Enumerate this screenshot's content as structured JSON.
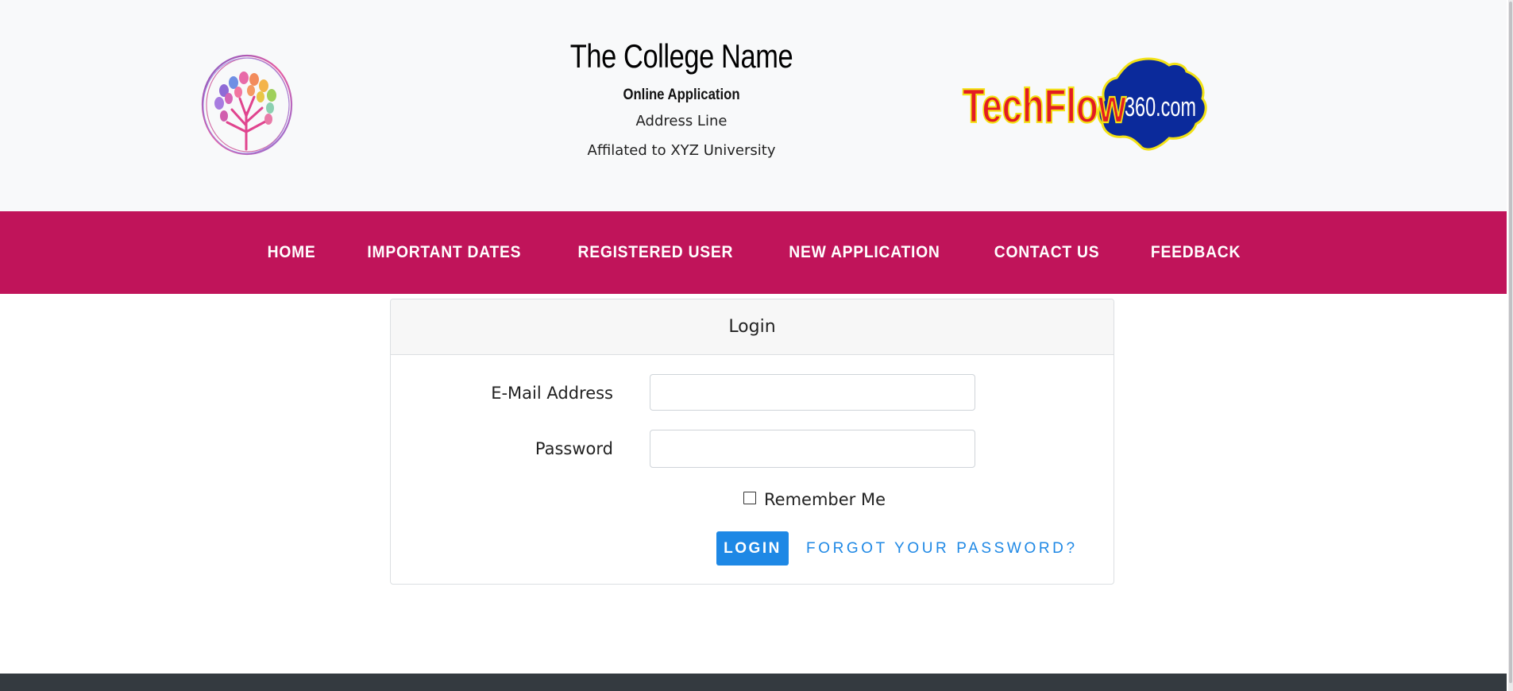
{
  "header": {
    "college_name": "The College Name",
    "subtitle": "Online Application",
    "address": "Address Line",
    "affiliation": "Affilated to XYZ University",
    "brand_logo": {
      "primary": "TechFlow",
      "suffix": "360.com"
    }
  },
  "nav": {
    "items": [
      {
        "label": "HOME"
      },
      {
        "label": "IMPORTANT DATES"
      },
      {
        "label": "REGISTERED USER"
      },
      {
        "label": "NEW APPLICATION"
      },
      {
        "label": "CONTACT US"
      },
      {
        "label": "FEEDBACK"
      }
    ]
  },
  "login": {
    "title": "Login",
    "email_label": "E-Mail Address",
    "email_value": "",
    "password_label": "Password",
    "password_value": "",
    "remember_label": "Remember Me",
    "remember_checked": false,
    "submit_label": "LOGIN",
    "forgot_label": "FORGOT YOUR PASSWORD?"
  },
  "colors": {
    "nav_bg": "#c0145a",
    "header_bg": "#f8f9fa",
    "primary": "#1e88e5",
    "footer_bg": "#343a40",
    "brand_text": "#e31b23",
    "brand_shape": "#0b2a9b",
    "brand_outline": "#f3e214"
  }
}
